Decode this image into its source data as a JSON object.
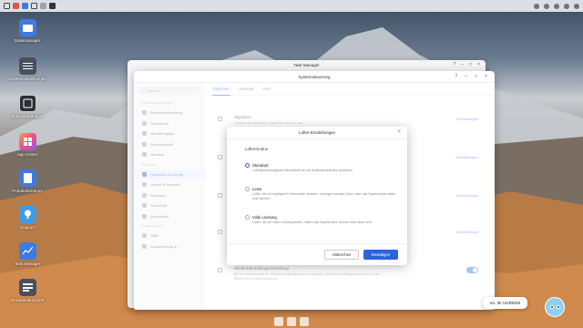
{
  "topbar": {
    "icons": [
      "grid-icon",
      "red-app-icon",
      "blue-app-icon",
      "window-icon",
      "file-icon",
      "task-icon"
    ],
    "right_icons": [
      "notification-icon",
      "settings-icon",
      "user-icon",
      "search-icon",
      "info-icon"
    ]
  },
  "desktop": {
    "icons": [
      {
        "label": "Dateimanager",
        "color": "#3d7be0"
      },
      {
        "label": "Systemeinstellungen",
        "color": "#48505c"
      },
      {
        "label": "Speichermanager",
        "color": "#2b2f36"
      },
      {
        "label": "App Center",
        "color": "#f04e8a"
      },
      {
        "label": "Protokollzentrum",
        "color": "#3d7be0"
      },
      {
        "label": "Support",
        "color": "#3d9be0"
      },
      {
        "label": "Task Manager",
        "color": "#3d7be0"
      },
      {
        "label": "Universelle Suche",
        "color": "#48505c"
      }
    ]
  },
  "taskmanager": {
    "title": "Task Manager"
  },
  "settings": {
    "title": "Systemsteuerung",
    "search_placeholder": "Suchen",
    "sidebar": {
      "section1": "Verbindung & Zugriff",
      "items1": [
        "Benutzerverwaltung",
        "Dateidienst",
        "Gerätefreigabe",
        "Remotezugriff",
        "Terminal"
      ],
      "section2": "Allgemein",
      "items2": [
        "Hardware & Energie",
        "Uhrzeit & Sprache",
        "Netzwerk",
        "Sicherheit",
        "Indexdienst"
      ],
      "section3": "Anwendungen",
      "items3": [
        "SMB",
        "Aktualisierung & ..."
      ]
    },
    "tabs": [
      "Allgemein",
      "Energie",
      "USV"
    ],
    "rows": [
      {
        "title": "Signalton",
        "desc": "Schalten Sie akustische Signaltöne ein oder aus.",
        "link": "Einstellungen"
      },
      {
        "title": "",
        "desc": "",
        "link": "Einstellungen"
      },
      {
        "title": "",
        "desc": "",
        "link": "Einstellungen"
      },
      {
        "title": "",
        "desc": "",
        "link": "Einstellungen"
      },
      {
        "title": "Wiederherstellungseinstellung",
        "desc": "Bei Stromausfall wird der Wiederherstellungsmodus ausgewählt. Wiederherstellungseinstellung für den Betrieb des Systems bestimmt.",
        "link": ""
      }
    ]
  },
  "modal": {
    "title": "Lüfter-Einstellungen",
    "section": "Lüftermodus",
    "options": [
      {
        "title": "Standard",
        "desc": "Lüftergeschwindigkeit automatisch an die Systemtemperatur anpassen",
        "selected": true
      },
      {
        "title": "Leise",
        "desc": "Lüfter, die mit niedrigeren Drehzahlen arbeiten, erzeugen weniger Lärm, aber das System kann dabei heiß werden.",
        "selected": false
      },
      {
        "title": "Volle Leistung",
        "desc": "Lüfter, die mit voller Leistung laufen, halten das System kühl, können aber laute sein.",
        "selected": false
      }
    ],
    "cancel_label": "Abbrechen",
    "confirm_label": "Bestätigen"
  },
  "assistant": {
    "bubble_text": "en. Ihr UGREEN"
  }
}
